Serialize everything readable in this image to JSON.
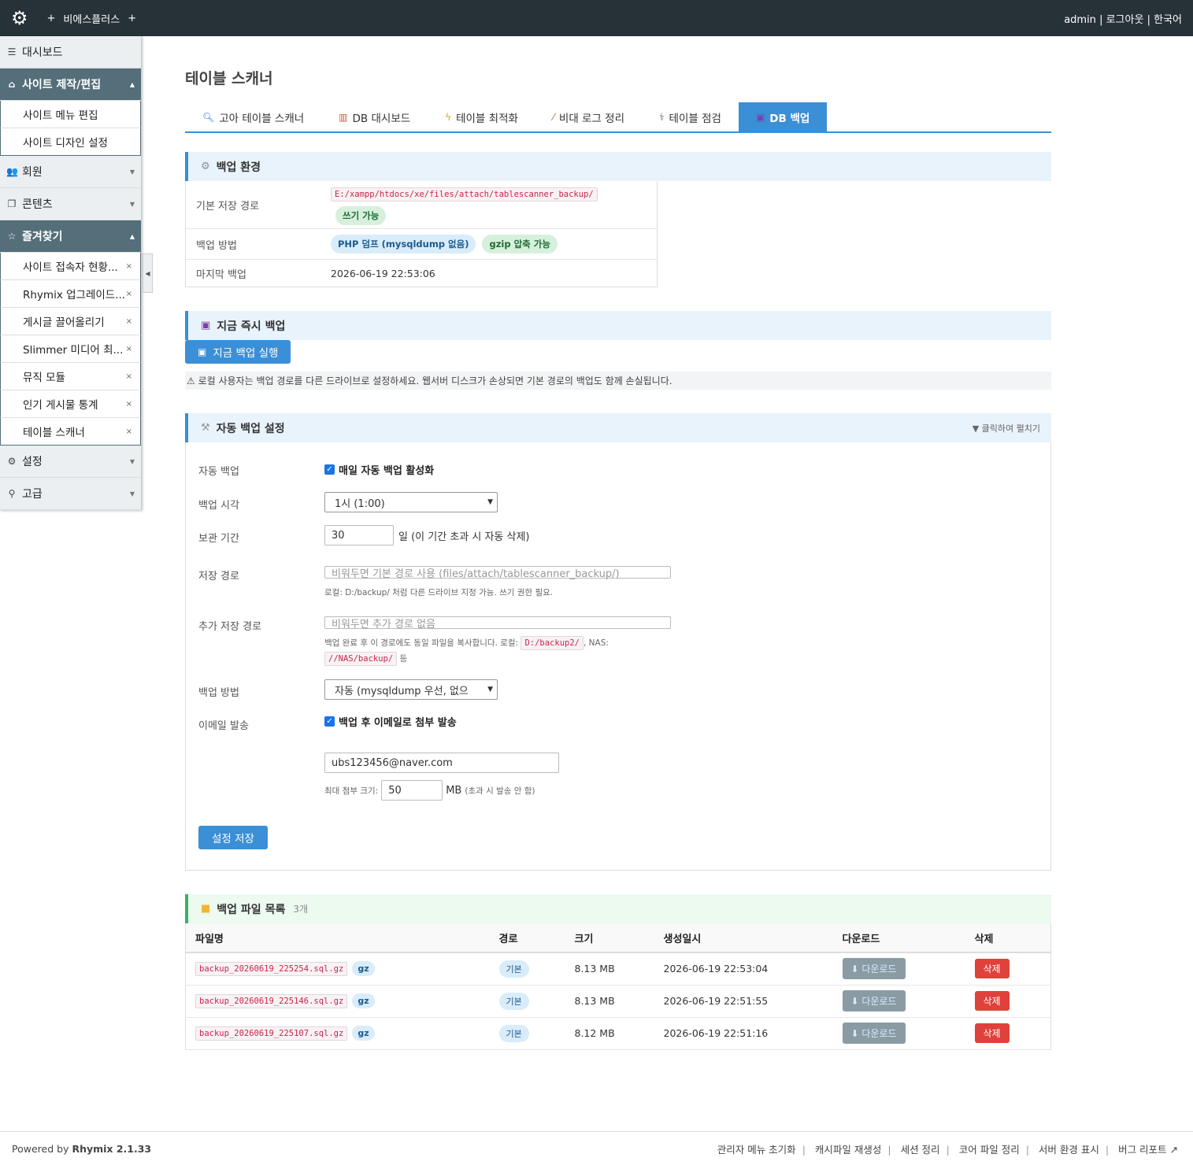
{
  "topbar": {
    "brand": "비에스플러스",
    "plus": "+",
    "user": "admin",
    "logout": "로그아웃",
    "lang": "한국어",
    "sep": "|"
  },
  "sidebar": {
    "dashboard": "대시보드",
    "site_edit": "사이트 제작/편집",
    "site_menu_edit": "사이트 메뉴 편집",
    "site_design": "사이트 디자인 설정",
    "member": "회원",
    "contents": "콘텐츠",
    "favorites": "즐겨찾기",
    "fav_items": [
      "사이트 접속자 현황...",
      "Rhymix 업그레이드...",
      "게시글 끌어올리기",
      "Slimmer 미디어 최...",
      "뮤직 모듈",
      "인기 게시물 통계",
      "테이블 스캐너"
    ],
    "settings": "설정",
    "advanced": "고급",
    "close_x": "×"
  },
  "page": {
    "title": "테이블 스캐너"
  },
  "tabs": [
    "고아 테이블 스캐너",
    "DB 대시보드",
    "테이블 최적화",
    "비대 로그 정리",
    "테이블 점검",
    "DB 백업"
  ],
  "env": {
    "title": "백업 환경",
    "path_label": "기본 저장 경로",
    "path_value": "E:/xampp/htdocs/xe/files/attach/tablescanner_backup/",
    "writable": "쓰기 가능",
    "method_label": "백업 방법",
    "method_php": "PHP 덤프 (mysqldump 없음)",
    "method_gzip": "gzip 압축 가능",
    "last_label": "마지막 백업",
    "last_value": "2026-06-19 22:53:06"
  },
  "instant": {
    "title": "지금 즉시 백업",
    "run_button": "지금 백업 실행",
    "warning": "⚠ 로컬 사용자는 백업 경로를 다른 드라이브로 설정하세요. 웹서버 디스크가 손상되면 기본 경로의 백업도 함께 손실됩니다."
  },
  "auto": {
    "title": "자동 백업 설정",
    "expand_note": "▼ 클릭하여 펼치기",
    "enable_label": "자동 백업",
    "enable_text": "매일 자동 백업 활성화",
    "time_label": "백업 시각",
    "time_value": "1시 (1:00)",
    "retention_label": "보관 기간",
    "retention_value": "30",
    "retention_suffix": "일 (이 기간 초과 시 자동 삭제)",
    "path_label": "저장 경로",
    "path_placeholder": "비워두면 기본 경로 사용 (files/attach/tablescanner_backup/)",
    "path_help": "로컬: D:/backup/ 처럼 다른 드라이브 지정 가능. 쓰기 권한 필요.",
    "extra_label": "추가 저장 경로",
    "extra_placeholder": "비워두면 추가 경로 없음",
    "extra_help_1": "백업 완료 후 이 경로에도 동일 파일을 복사합니다. 로컬:",
    "extra_code_1": "D:/backup2/",
    "extra_help_2": ", NAS:",
    "extra_code_2": "//NAS/backup/",
    "extra_help_3": "등",
    "method_label": "백업 방법",
    "method_value": "자동 (mysqldump 우선, 없으",
    "email_label": "이메일 발송",
    "email_text": "백업 후 이메일로 첨부 발송",
    "email_value": "ubs123456@naver.com",
    "max_label": "최대 첨부 크기:",
    "max_value": "50",
    "max_unit": "MB",
    "max_note": "(초과 시 발송 안 함)",
    "save_button": "설정 저장"
  },
  "files": {
    "title": "백업 파일 목록",
    "count": "3개",
    "headers": [
      "파일명",
      "경로",
      "크기",
      "생성일시",
      "다운로드",
      "삭제"
    ],
    "gz": "gz",
    "download": "⬇ 다운로드",
    "delete": "삭제",
    "rows": [
      {
        "name": "backup_20260619_225254.sql.gz",
        "path": "기본",
        "size": "8.13 MB",
        "date": "2026-06-19 22:53:04"
      },
      {
        "name": "backup_20260619_225146.sql.gz",
        "path": "기본",
        "size": "8.13 MB",
        "date": "2026-06-19 22:51:55"
      },
      {
        "name": "backup_20260619_225107.sql.gz",
        "path": "기본",
        "size": "8.12 MB",
        "date": "2026-06-19 22:51:16"
      }
    ]
  },
  "footer": {
    "powered": "Powered by",
    "product": "Rhymix 2.1.33",
    "links": [
      "관리자 메뉴 초기화",
      "캐시파일 재생성",
      "세션 정리",
      "코어 파일 정리",
      "서버 환경 표시",
      "버그 리포트 ↗"
    ],
    "sep": "|"
  }
}
